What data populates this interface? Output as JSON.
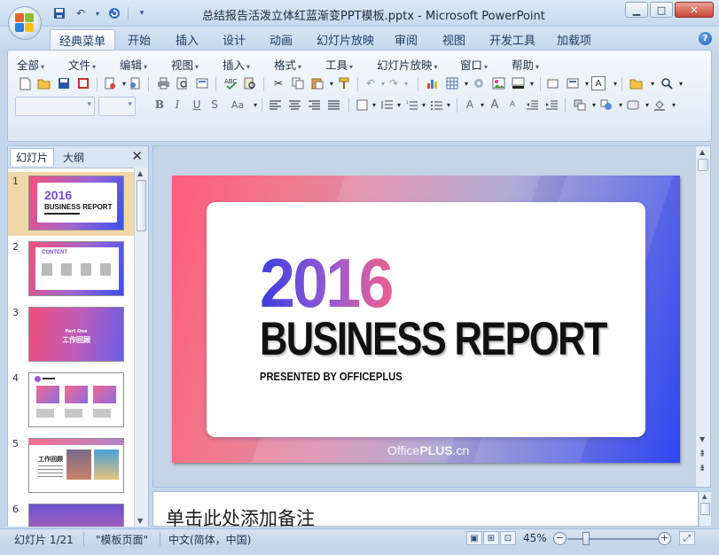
{
  "window": {
    "title": "总结报告活泼立体红蓝渐变PPT模板.pptx - Microsoft PowerPoint",
    "minimize": "▁",
    "maximize": "□",
    "close": "✕"
  },
  "ribbon_tabs": [
    "经典菜单",
    "开始",
    "插入",
    "设计",
    "动画",
    "幻灯片放映",
    "审阅",
    "视图",
    "开发工具",
    "加载项"
  ],
  "active_tab": "经典菜单",
  "classic_menu": [
    "全部",
    "文件",
    "编辑",
    "视图",
    "插入",
    "格式",
    "工具",
    "幻灯片放映",
    "窗口",
    "帮助"
  ],
  "panel": {
    "tabs": [
      "幻灯片",
      "大纲"
    ],
    "close": "✕",
    "slide_numbers": [
      "1",
      "2",
      "3",
      "4",
      "5",
      "6"
    ],
    "thumb1": {
      "year": "2016",
      "title": "BUSINESS REPORT"
    },
    "thumb2": {
      "title": "CONTENT"
    },
    "thumb3": {
      "part": "Part One",
      "title": "工作回顾"
    },
    "thumb5": {
      "title": "工作回顾"
    }
  },
  "slide": {
    "year": "2016",
    "title": "BUSINESS REPORT",
    "subtitle": "PRESENTED BY OFFICEPLUS",
    "brand_prefix": "Office",
    "brand_bold": "PLUS",
    "brand_suffix": ".cn"
  },
  "notes": {
    "placeholder": "单击此处添加备注"
  },
  "status": {
    "slide_info": "幻灯片 1/21",
    "theme": "\"模板页面\"",
    "language": "中文(简体，中国)",
    "zoom": "45%",
    "zoom_level_percent": 45
  },
  "colors": {
    "gradient_start": "#ff5b7c",
    "gradient_end": "#2f46f2",
    "selected_thumb": "#f1d8a8"
  }
}
